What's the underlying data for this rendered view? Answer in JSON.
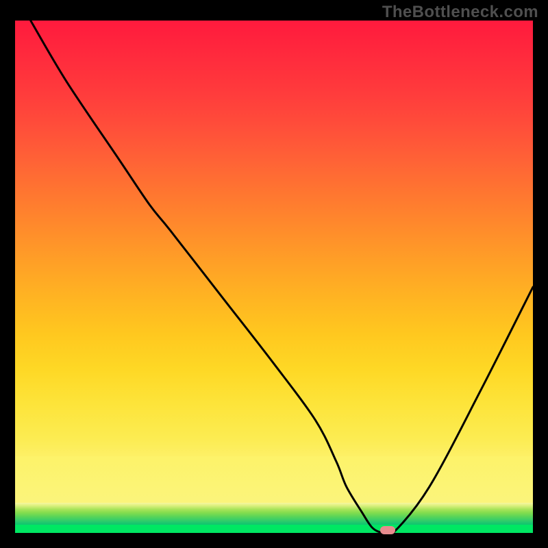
{
  "watermark": "TheBottleneck.com",
  "chart_data": {
    "type": "line",
    "title": "",
    "xlabel": "",
    "ylabel": "",
    "xlim": [
      0,
      100
    ],
    "ylim": [
      0,
      100
    ],
    "background": {
      "main_gradient": [
        "#ff1a3d",
        "#ff6236",
        "#ffa126",
        "#fcec52"
      ],
      "pale_band": "#fbf47c",
      "green_base": "#00e763"
    },
    "series": [
      {
        "name": "curve",
        "x": [
          3,
          10,
          20,
          26,
          30,
          40,
          50,
          58,
          62,
          64,
          67,
          69,
          71,
          73,
          80,
          90,
          100
        ],
        "values": [
          100,
          88,
          73,
          64,
          59,
          46,
          33,
          22,
          14,
          9,
          4,
          1,
          0,
          0,
          9,
          28,
          48
        ]
      }
    ],
    "marker": {
      "x": 72,
      "y": 0,
      "color": "#e78b8e"
    },
    "grid": false,
    "legend": false
  }
}
